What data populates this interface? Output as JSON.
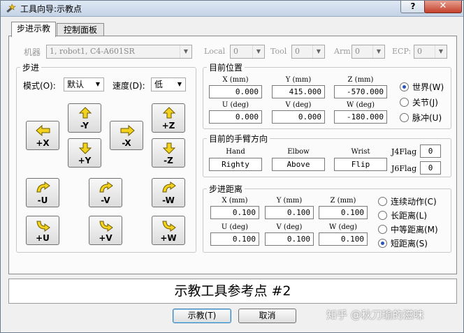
{
  "window": {
    "title": "工具向导:示教点",
    "help_label": "?",
    "close_label": "✕"
  },
  "tabs": [
    {
      "label": "步进示教",
      "active": true
    },
    {
      "label": "控制面板",
      "active": false
    }
  ],
  "robot_row": {
    "robot_label": "机器",
    "robot_value": "1, robot1, C4-A601SR",
    "local_label": "Local",
    "local_value": "0",
    "tool_label": "Tool",
    "tool_value": "0",
    "arm_label": "Arm",
    "arm_value": "0",
    "ecp_label": "ECP:",
    "ecp_value": "0"
  },
  "jog": {
    "title": "步进",
    "mode_label": "模式(O):",
    "mode_value": "默认",
    "speed_label": "速度(D):",
    "speed_value": "低",
    "buttons": {
      "minus_y": "-Y",
      "plus_z": "+Z",
      "plus_x": "+X",
      "minus_x": "-X",
      "plus_y": "+Y",
      "minus_z": "-Z",
      "minus_u": "-U",
      "minus_v": "-V",
      "minus_w": "-W",
      "plus_u": "+U",
      "plus_v": "+V",
      "plus_w": "+W"
    }
  },
  "current_position": {
    "title": "目前位置",
    "headers": [
      "X (mm)",
      "Y (mm)",
      "Z (mm)",
      "U (deg)",
      "V (deg)",
      "W (deg)"
    ],
    "values": [
      "0.000",
      "415.000",
      "-570.000",
      "0.000",
      "0.000",
      "-180.000"
    ],
    "coord_options": [
      {
        "label": "世界(W)",
        "selected": true
      },
      {
        "label": "关节(J)",
        "selected": false
      },
      {
        "label": "脉冲(U)",
        "selected": false
      }
    ]
  },
  "arm_orientation": {
    "title": "目前的手臂方向",
    "headers": [
      "Hand",
      "Elbow",
      "Wrist"
    ],
    "values": [
      "Righty",
      "Above",
      "Flip"
    ],
    "j4flag_label": "J4Flag",
    "j4flag_value": "0",
    "j6flag_label": "J6Flag",
    "j6flag_value": "0"
  },
  "jog_distance": {
    "title": "步进距离",
    "headers": [
      "X (mm)",
      "Y (mm)",
      "Z (mm)",
      "U (deg)",
      "V (deg)",
      "W (deg)"
    ],
    "values": [
      "0.100",
      "0.100",
      "0.100",
      "0.100",
      "0.100",
      "0.100"
    ],
    "options": [
      {
        "label": "连续动作(C)",
        "selected": false
      },
      {
        "label": "长距离(L)",
        "selected": false
      },
      {
        "label": "中等距离(M)",
        "selected": false
      },
      {
        "label": "短距离(S)",
        "selected": true
      }
    ]
  },
  "message": "示教工具参考点 #2",
  "footer": {
    "teach_label": "示教(T)",
    "cancel_label": "取消"
  },
  "watermark": "知乎 @秋刀瑜的滋味",
  "colors": {
    "arrow_fill": "#f3d21d",
    "arrow_stroke": "#6b5a00",
    "radio_dot": "#2a55b8",
    "close_button": "#c4412c"
  }
}
